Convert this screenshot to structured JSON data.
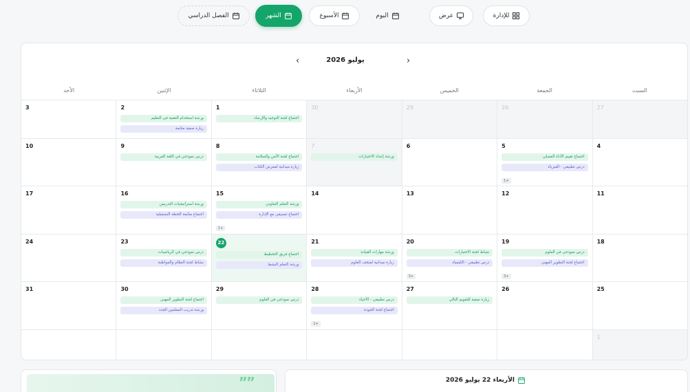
{
  "toolbar": {
    "admin": "للإدارة",
    "display": "عرض",
    "day": "اليوم",
    "week": "الأسبوع",
    "month": "الشهر",
    "semester": "الفصل الدراسي"
  },
  "calendar": {
    "month_title": "يوليو 2026",
    "weekdays": [
      "السبت",
      "الجمعة",
      "الخميس",
      "الأربعاء",
      "الثلاثاء",
      "الإثنين",
      "الأحد"
    ],
    "weeks": [
      [
        {
          "day": "27",
          "other": true,
          "events": []
        },
        {
          "day": "26",
          "other": true,
          "events": []
        },
        {
          "day": "29",
          "other": true,
          "events": []
        },
        {
          "day": "30",
          "other": true,
          "events": []
        },
        {
          "day": "1",
          "events": [
            {
              "t": "اجتماع لجنة التوجيه والإرشاد",
              "c": "g"
            }
          ]
        },
        {
          "day": "2",
          "events": [
            {
              "t": "ورشة استخدام التقنية في التعليم",
              "c": "g"
            },
            {
              "t": "زيارة صفية متابعة",
              "c": "p"
            }
          ]
        },
        {
          "day": "3",
          "events": []
        }
      ],
      [
        {
          "day": "4",
          "events": []
        },
        {
          "day": "5",
          "events": [
            {
              "t": "اجتماع تقييم الأداء الفصلي",
              "c": "g"
            },
            {
              "t": "درس تطبيقي - الفيزياء",
              "c": "p"
            }
          ],
          "more": "1+"
        },
        {
          "day": "6",
          "events": []
        },
        {
          "day": "7",
          "other": true,
          "events": [
            {
              "t": "ورشة إعداد الاختبارات",
              "c": "g"
            }
          ]
        },
        {
          "day": "8",
          "events": [
            {
              "t": "اجتماع لجنة الأمن والسلامة",
              "c": "g"
            },
            {
              "t": "زيارة ميدانية لمعرض الكتاب",
              "c": "p"
            }
          ]
        },
        {
          "day": "9",
          "events": [
            {
              "t": "درس نموذجي في اللغة العربية",
              "c": "g"
            }
          ]
        },
        {
          "day": "10",
          "events": []
        }
      ],
      [
        {
          "day": "11",
          "events": []
        },
        {
          "day": "12",
          "events": []
        },
        {
          "day": "13",
          "events": []
        },
        {
          "day": "14",
          "events": []
        },
        {
          "day": "15",
          "events": [
            {
              "t": "ورشة التعلم التعاوني",
              "c": "g"
            },
            {
              "t": "اجتماع تنسيقي مع الإدارة",
              "c": "p"
            }
          ],
          "more": "1+"
        },
        {
          "day": "16",
          "events": [
            {
              "t": "ورشة استراتيجيات التدريس",
              "c": "g"
            },
            {
              "t": "اجتماع متابعة الخطة التشغيلية",
              "c": "p"
            }
          ]
        },
        {
          "day": "17",
          "events": []
        }
      ],
      [
        {
          "day": "18",
          "events": []
        },
        {
          "day": "19",
          "events": [
            {
              "t": "درس نموذجي في العلوم",
              "c": "g"
            },
            {
              "t": "اجتماع لجنة التطوير المهني",
              "c": "p"
            }
          ],
          "more": "3+"
        },
        {
          "day": "20",
          "events": [
            {
              "t": "نشاط لجنة الاختبارات",
              "c": "g"
            },
            {
              "t": "درس تطبيقي - الكيمياء",
              "c": "p"
            }
          ],
          "more": "3+"
        },
        {
          "day": "21",
          "events": [
            {
              "t": "ورشة مهارات القيادة",
              "c": "g"
            },
            {
              "t": "زيارة ميدانية لمتحف العلوم",
              "c": "p"
            }
          ]
        },
        {
          "day": "22",
          "today": true,
          "events": [
            {
              "t": "اجتماع فريق التخطيط",
              "c": "g"
            },
            {
              "t": "ورشة التعلم النشط",
              "c": "p"
            }
          ]
        },
        {
          "day": "23",
          "events": [
            {
              "t": "درس نموذجي في الرياضيات",
              "c": "g"
            },
            {
              "t": "نشاط لجنة النظام والمواظبة",
              "c": "p"
            }
          ]
        },
        {
          "day": "24",
          "events": []
        }
      ],
      [
        {
          "day": "25",
          "events": []
        },
        {
          "day": "26",
          "events": []
        },
        {
          "day": "27",
          "events": [
            {
              "t": "زيارة صفية للتقويم التالي",
              "c": "g"
            }
          ]
        },
        {
          "day": "28",
          "events": [
            {
              "t": "درس تطبيقي - الأحياء",
              "c": "g"
            },
            {
              "t": "اجتماع لجنة الجودة",
              "c": "p"
            }
          ],
          "more": "1+"
        },
        {
          "day": "29",
          "events": [
            {
              "t": "درس نموذجي في العلوم",
              "c": "g"
            }
          ]
        },
        {
          "day": "30",
          "events": [
            {
              "t": "اجتماع لجنة التطوير المهني",
              "c": "g"
            },
            {
              "t": "ورشة تدريب المعلمين الجدد",
              "c": "p"
            }
          ]
        },
        {
          "day": "31",
          "events": []
        }
      ],
      [
        {
          "day": "1",
          "other": true,
          "events": []
        },
        {
          "day": "",
          "events": []
        },
        {
          "day": "",
          "events": []
        },
        {
          "day": "",
          "events": []
        },
        {
          "day": "",
          "events": []
        },
        {
          "day": "",
          "events": []
        },
        {
          "day": "",
          "events": []
        }
      ]
    ]
  },
  "selected_day": {
    "label": "الأربعاء 22 يوليو 2026"
  },
  "colors": {
    "accent": "#14a56a",
    "event_green_bg": "#e2f5ea",
    "event_purple_bg": "#e8e8fb"
  }
}
